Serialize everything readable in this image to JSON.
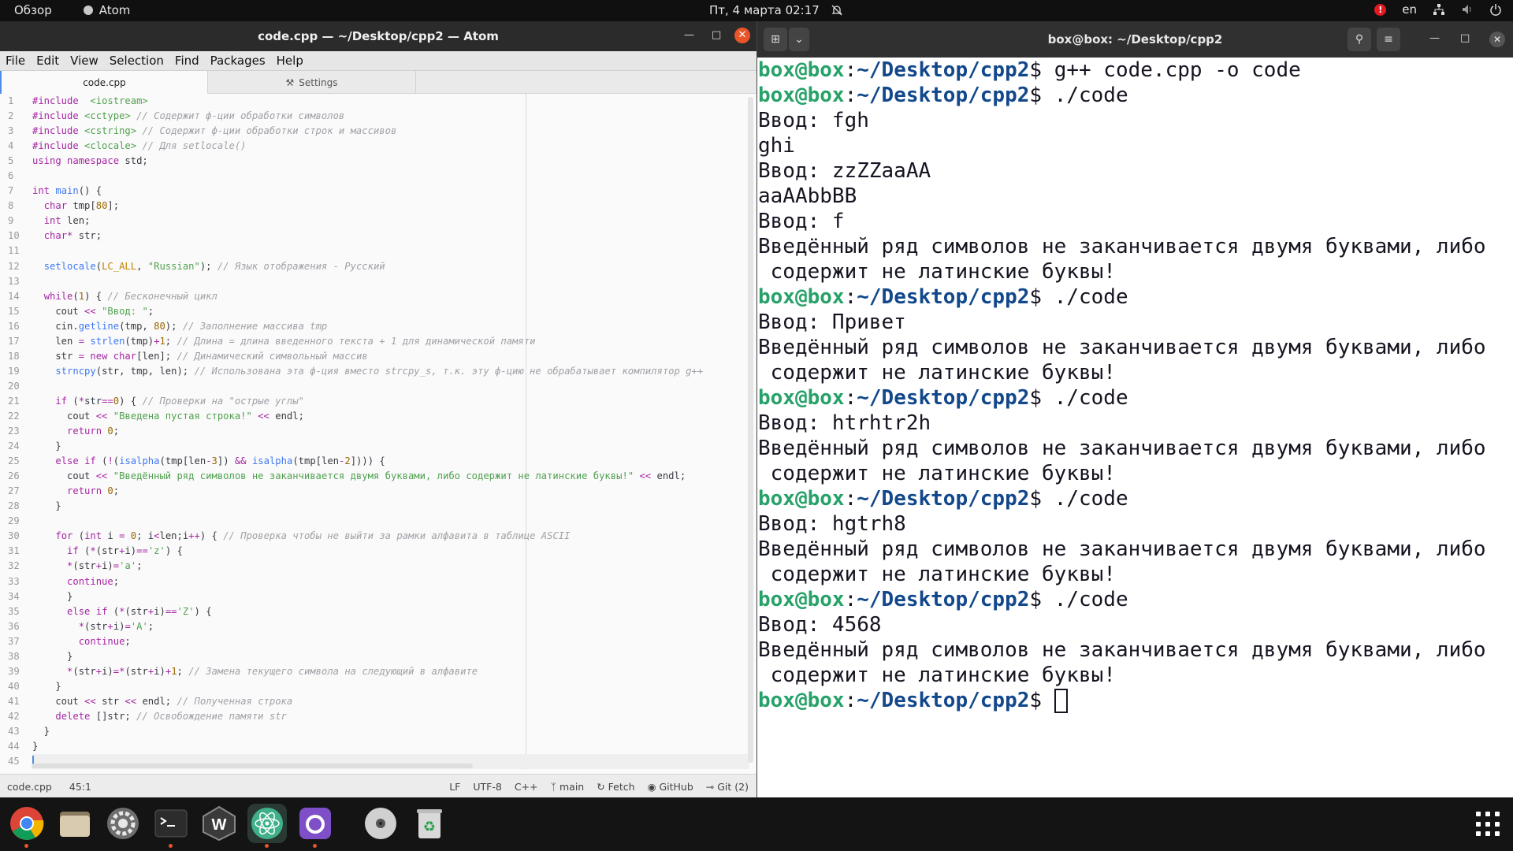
{
  "top_panel": {
    "overview": "Обзор",
    "app_name": "Atom",
    "datetime": "Пт, 4 марта  02:17",
    "alert_badge": "!",
    "lang": "en"
  },
  "atom": {
    "title": "code.cpp — ~/Desktop/cpp2 — Atom",
    "menu": [
      "File",
      "Edit",
      "View",
      "Selection",
      "Find",
      "Packages",
      "Help"
    ],
    "tabs": [
      {
        "label": "code.cpp",
        "active": true
      },
      {
        "label": "Settings",
        "active": false
      }
    ],
    "current_line": 45,
    "status": {
      "file": "code.cpp",
      "position": "45:1",
      "line_ending": "LF",
      "encoding": "UTF-8",
      "grammar": "C++",
      "branch": "main",
      "fetch": "Fetch",
      "github": "GitHub",
      "git": "Git (2)"
    },
    "colors": {
      "keyword": "#a626a4",
      "type": "#4078f2",
      "string": "#50a14f",
      "number": "#986801",
      "comment": "#a0a1a7"
    },
    "code_lines": [
      [
        [
          "pp",
          "#include"
        ],
        [
          "",
          "  "
        ],
        [
          "ic",
          "<iostream>"
        ]
      ],
      [
        [
          "pp",
          "#include"
        ],
        [
          "",
          " "
        ],
        [
          "ic",
          "<cctype>"
        ],
        [
          "",
          " "
        ],
        [
          "cm",
          "// Содержит ф-ции обработки символов"
        ]
      ],
      [
        [
          "pp",
          "#include"
        ],
        [
          "",
          " "
        ],
        [
          "ic",
          "<cstring>"
        ],
        [
          "",
          " "
        ],
        [
          "cm",
          "// Содержит ф-ции обработки строк и массивов"
        ]
      ],
      [
        [
          "pp",
          "#include"
        ],
        [
          "",
          " "
        ],
        [
          "ic",
          "<clocale>"
        ],
        [
          "",
          " "
        ],
        [
          "cm",
          "// Для setlocale()"
        ]
      ],
      [
        [
          "kw",
          "using"
        ],
        [
          "",
          " "
        ],
        [
          "kw",
          "namespace"
        ],
        [
          "",
          " std;"
        ]
      ],
      [],
      [
        [
          "kw",
          "int"
        ],
        [
          "",
          " "
        ],
        [
          "fn",
          "main"
        ],
        [
          "",
          "() {"
        ]
      ],
      [
        [
          "",
          "  "
        ],
        [
          "kw",
          "char"
        ],
        [
          "",
          " tmp["
        ],
        [
          "num",
          "80"
        ],
        [
          "",
          "];"
        ]
      ],
      [
        [
          "",
          "  "
        ],
        [
          "kw",
          "int"
        ],
        [
          "",
          " len;"
        ]
      ],
      [
        [
          "",
          "  "
        ],
        [
          "kw",
          "char"
        ],
        [
          "op",
          "*"
        ],
        [
          "",
          " str;"
        ]
      ],
      [],
      [
        [
          "",
          "  "
        ],
        [
          "fn",
          "setlocale"
        ],
        [
          "",
          "("
        ],
        [
          "cs",
          "LC_ALL"
        ],
        [
          "",
          ", "
        ],
        [
          "str",
          "\"Russian\""
        ],
        [
          "",
          "); "
        ],
        [
          "cm",
          "// Язык отображения - Русский"
        ]
      ],
      [],
      [
        [
          "",
          "  "
        ],
        [
          "kw",
          "while"
        ],
        [
          "",
          "("
        ],
        [
          "num",
          "1"
        ],
        [
          "",
          ") { "
        ],
        [
          "cm",
          "// Бесконечный цикл"
        ]
      ],
      [
        [
          "",
          "    cout "
        ],
        [
          "op",
          "<<"
        ],
        [
          "",
          " "
        ],
        [
          "str",
          "\"Ввод: \""
        ],
        [
          "",
          ";"
        ]
      ],
      [
        [
          "",
          "    cin."
        ],
        [
          "fn",
          "getline"
        ],
        [
          "",
          "(tmp, "
        ],
        [
          "num",
          "80"
        ],
        [
          "",
          "); "
        ],
        [
          "cm",
          "// Заполнение массива tmp"
        ]
      ],
      [
        [
          "",
          "    len "
        ],
        [
          "op",
          "="
        ],
        [
          "",
          " "
        ],
        [
          "fn",
          "strlen"
        ],
        [
          "",
          "(tmp)"
        ],
        [
          "op",
          "+"
        ],
        [
          "num",
          "1"
        ],
        [
          "",
          "; "
        ],
        [
          "cm",
          "// Длина = длина введенного текста + 1 для динамической памяти"
        ]
      ],
      [
        [
          "",
          "    str "
        ],
        [
          "op",
          "="
        ],
        [
          "",
          " "
        ],
        [
          "kw",
          "new"
        ],
        [
          "",
          " "
        ],
        [
          "kw",
          "char"
        ],
        [
          "",
          "[len]; "
        ],
        [
          "cm",
          "// Динамический символьный массив"
        ]
      ],
      [
        [
          "",
          "    "
        ],
        [
          "fn",
          "strncpy"
        ],
        [
          "",
          "(str, tmp, len); "
        ],
        [
          "cm",
          "// Использована эта ф-ция вместо strcpy_s, т.к. эту ф-цию не обрабатывает компилятор g++"
        ]
      ],
      [],
      [
        [
          "",
          "    "
        ],
        [
          "kw",
          "if"
        ],
        [
          "",
          " ("
        ],
        [
          "op",
          "*"
        ],
        [
          "",
          "str"
        ],
        [
          "op",
          "=="
        ],
        [
          "num",
          "0"
        ],
        [
          "",
          ") { "
        ],
        [
          "cm",
          "// Проверки на \"острые углы\""
        ]
      ],
      [
        [
          "",
          "      cout "
        ],
        [
          "op",
          "<<"
        ],
        [
          "",
          " "
        ],
        [
          "str",
          "\"Введена пустая строка!\""
        ],
        [
          "",
          " "
        ],
        [
          "op",
          "<<"
        ],
        [
          "",
          " endl;"
        ]
      ],
      [
        [
          "",
          "      "
        ],
        [
          "kw",
          "return"
        ],
        [
          "",
          " "
        ],
        [
          "num",
          "0"
        ],
        [
          "",
          ";"
        ]
      ],
      [
        [
          "",
          "    }"
        ]
      ],
      [
        [
          "",
          "    "
        ],
        [
          "kw",
          "else"
        ],
        [
          "",
          " "
        ],
        [
          "kw",
          "if"
        ],
        [
          "",
          " ("
        ],
        [
          "op",
          "!"
        ],
        [
          "",
          "("
        ],
        [
          "fn",
          "isalpha"
        ],
        [
          "",
          "(tmp[len"
        ],
        [
          "op",
          "-"
        ],
        [
          "num",
          "3"
        ],
        [
          "",
          "]) "
        ],
        [
          "op",
          "&&"
        ],
        [
          "",
          " "
        ],
        [
          "fn",
          "isalpha"
        ],
        [
          "",
          "(tmp[len"
        ],
        [
          "op",
          "-"
        ],
        [
          "num",
          "2"
        ],
        [
          "",
          "]))) {"
        ]
      ],
      [
        [
          "",
          "      cout "
        ],
        [
          "op",
          "<<"
        ],
        [
          "",
          " "
        ],
        [
          "str",
          "\"Введённый ряд символов не заканчивается двумя буквами, либо содержит не латинские буквы!\""
        ],
        [
          "",
          " "
        ],
        [
          "op",
          "<<"
        ],
        [
          "",
          " endl;"
        ]
      ],
      [
        [
          "",
          "      "
        ],
        [
          "kw",
          "return"
        ],
        [
          "",
          " "
        ],
        [
          "num",
          "0"
        ],
        [
          "",
          ";"
        ]
      ],
      [
        [
          "",
          "    }"
        ]
      ],
      [],
      [
        [
          "",
          "    "
        ],
        [
          "kw",
          "for"
        ],
        [
          "",
          " ("
        ],
        [
          "kw",
          "int"
        ],
        [
          "",
          " i "
        ],
        [
          "op",
          "="
        ],
        [
          "",
          " "
        ],
        [
          "num",
          "0"
        ],
        [
          "",
          "; i"
        ],
        [
          "op",
          "<"
        ],
        [
          "",
          "len;i"
        ],
        [
          "op",
          "++"
        ],
        [
          "",
          ") { "
        ],
        [
          "cm",
          "// Проверка чтобы не выйти за рамки алфавита в таблице ASCII"
        ]
      ],
      [
        [
          "",
          "      "
        ],
        [
          "kw",
          "if"
        ],
        [
          "",
          " ("
        ],
        [
          "op",
          "*"
        ],
        [
          "",
          "(str"
        ],
        [
          "op",
          "+"
        ],
        [
          "",
          "i)"
        ],
        [
          "op",
          "=="
        ],
        [
          "str",
          "'z'"
        ],
        [
          "",
          ") {"
        ]
      ],
      [
        [
          "",
          "      "
        ],
        [
          "op",
          "*"
        ],
        [
          "",
          "(str"
        ],
        [
          "op",
          "+"
        ],
        [
          "",
          "i)"
        ],
        [
          "op",
          "="
        ],
        [
          "str",
          "'a'"
        ],
        [
          "",
          ";"
        ]
      ],
      [
        [
          "",
          "      "
        ],
        [
          "kw",
          "continue"
        ],
        [
          "",
          ";"
        ]
      ],
      [
        [
          "",
          "      }"
        ]
      ],
      [
        [
          "",
          "      "
        ],
        [
          "kw",
          "else"
        ],
        [
          "",
          " "
        ],
        [
          "kw",
          "if"
        ],
        [
          "",
          " ("
        ],
        [
          "op",
          "*"
        ],
        [
          "",
          "(str"
        ],
        [
          "op",
          "+"
        ],
        [
          "",
          "i)"
        ],
        [
          "op",
          "=="
        ],
        [
          "str",
          "'Z'"
        ],
        [
          "",
          ") {"
        ]
      ],
      [
        [
          "",
          "        "
        ],
        [
          "op",
          "*"
        ],
        [
          "",
          "(str"
        ],
        [
          "op",
          "+"
        ],
        [
          "",
          "i)"
        ],
        [
          "op",
          "="
        ],
        [
          "str",
          "'A'"
        ],
        [
          "",
          ";"
        ]
      ],
      [
        [
          "",
          "        "
        ],
        [
          "kw",
          "continue"
        ],
        [
          "",
          ";"
        ]
      ],
      [
        [
          "",
          "      }"
        ]
      ],
      [
        [
          "",
          "      "
        ],
        [
          "op",
          "*"
        ],
        [
          "",
          "(str"
        ],
        [
          "op",
          "+"
        ],
        [
          "",
          "i)"
        ],
        [
          "op",
          "="
        ],
        [
          "op",
          "*"
        ],
        [
          "",
          "(str"
        ],
        [
          "op",
          "+"
        ],
        [
          "",
          "i)"
        ],
        [
          "op",
          "+"
        ],
        [
          "num",
          "1"
        ],
        [
          "",
          "; "
        ],
        [
          "cm",
          "// Замена текущего символа на следующий в алфавите"
        ]
      ],
      [
        [
          "",
          "    }"
        ]
      ],
      [
        [
          "",
          "    cout "
        ],
        [
          "op",
          "<<"
        ],
        [
          "",
          " str "
        ],
        [
          "op",
          "<<"
        ],
        [
          "",
          " endl; "
        ],
        [
          "cm",
          "// Полученная строка"
        ]
      ],
      [
        [
          "",
          "    "
        ],
        [
          "kw",
          "delete"
        ],
        [
          "",
          " []str; "
        ],
        [
          "cm",
          "// Освобождение памяти str"
        ]
      ],
      [
        [
          "",
          "  }"
        ]
      ],
      [
        [
          "",
          "}"
        ]
      ],
      []
    ]
  },
  "terminal": {
    "title": "box@box: ~/Desktop/cpp2",
    "colors": {
      "prompt_user": "#26a269",
      "prompt_path": "#12488b"
    },
    "prompt_user": "box@box",
    "prompt_path": "~/Desktop/cpp2",
    "lines": [
      {
        "type": "cmd",
        "text": "g++ code.cpp -o code"
      },
      {
        "type": "cmd",
        "text": "./code"
      },
      {
        "type": "out",
        "text": "Ввод: fgh"
      },
      {
        "type": "out",
        "text": "ghi"
      },
      {
        "type": "out",
        "text": "Ввод: zzZZaaAA"
      },
      {
        "type": "out",
        "text": "aaAAbbBB"
      },
      {
        "type": "out",
        "text": "Ввод: f"
      },
      {
        "type": "out",
        "text": "Введённый ряд символов не заканчивается двумя буквами, либо"
      },
      {
        "type": "out",
        "text": " содержит не латинские буквы!"
      },
      {
        "type": "cmd",
        "text": "./code"
      },
      {
        "type": "out",
        "text": "Ввод: Привет"
      },
      {
        "type": "out",
        "text": "Введённый ряд символов не заканчивается двумя буквами, либо"
      },
      {
        "type": "out",
        "text": " содержит не латинские буквы!"
      },
      {
        "type": "cmd",
        "text": "./code"
      },
      {
        "type": "out",
        "text": "Ввод: htrhtr2h"
      },
      {
        "type": "out",
        "text": "Введённый ряд символов не заканчивается двумя буквами, либо"
      },
      {
        "type": "out",
        "text": " содержит не латинские буквы!"
      },
      {
        "type": "cmd",
        "text": "./code"
      },
      {
        "type": "out",
        "text": "Ввод: hgtrh8"
      },
      {
        "type": "out",
        "text": "Введённый ряд символов не заканчивается двумя буквами, либо"
      },
      {
        "type": "out",
        "text": " содержит не латинские буквы!"
      },
      {
        "type": "cmd",
        "text": "./code"
      },
      {
        "type": "out",
        "text": "Ввод: 4568"
      },
      {
        "type": "out",
        "text": "Введённый ряд символов не заканчивается двумя буквами, либо"
      },
      {
        "type": "out",
        "text": " содержит не латинские буквы!"
      },
      {
        "type": "cmd",
        "text": ""
      }
    ]
  },
  "dock": {
    "apps": [
      {
        "name": "chrome-icon",
        "running": true,
        "color": "#e8e8e8"
      },
      {
        "name": "files-icon",
        "running": false,
        "color": "#c8b99a"
      },
      {
        "name": "settings-icon",
        "running": false,
        "color": "#8e8e8e"
      },
      {
        "name": "terminal-icon",
        "running": true,
        "color": "#2c2c2c"
      },
      {
        "name": "webstorm-icon",
        "running": false,
        "color": "#1e1e1e"
      },
      {
        "name": "atom-icon",
        "running": true,
        "color": "#3fb08a"
      },
      {
        "name": "github-desktop-icon",
        "running": true,
        "color": "#7e4fc7"
      },
      {
        "name": "disc-icon",
        "running": false,
        "color": "#cfcfcf"
      },
      {
        "name": "trash-icon",
        "running": false,
        "color": "#d9d9d9"
      }
    ]
  }
}
